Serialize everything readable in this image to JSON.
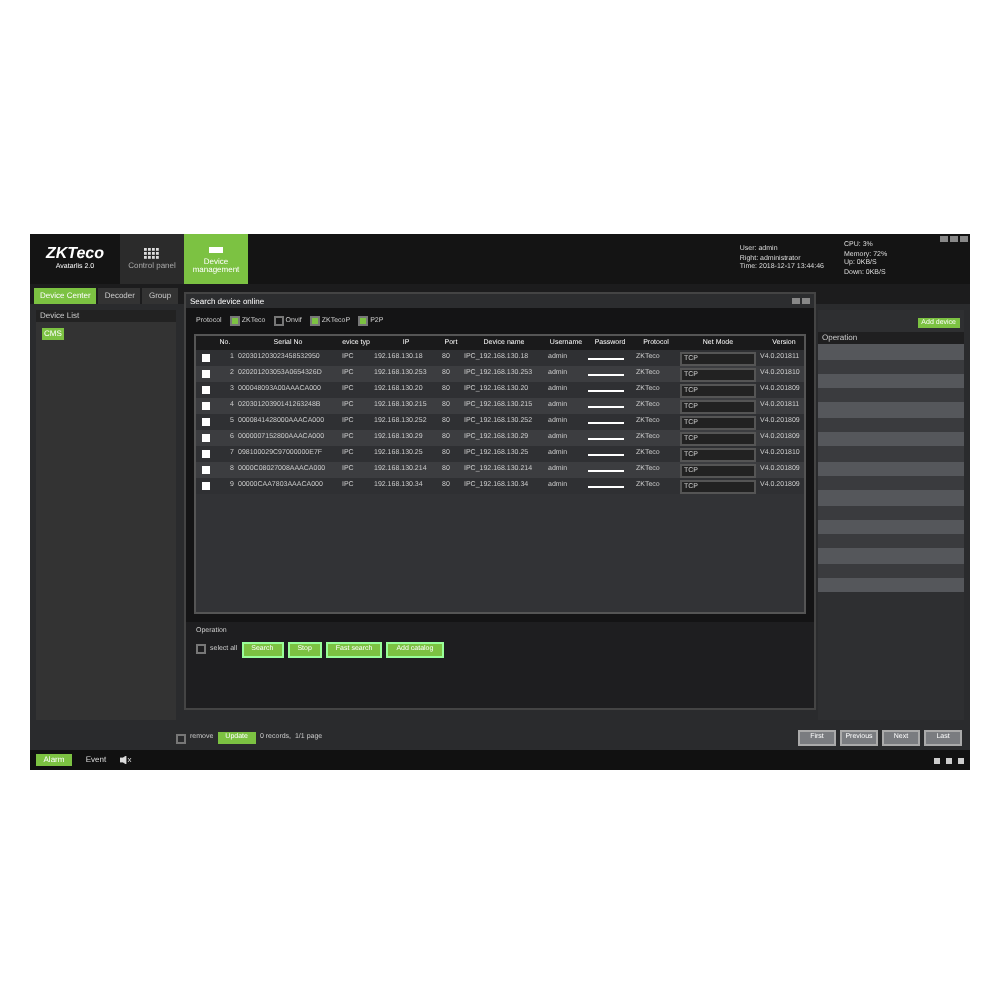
{
  "logo": {
    "brand": "ZKTeco",
    "product": "Avatarlis 2.0"
  },
  "main_tabs": [
    {
      "label": "Control panel",
      "selected": false
    },
    {
      "label": "Device management",
      "selected": true
    }
  ],
  "session": {
    "user": "User: admin",
    "right": "Right: administrator",
    "time": "Time: 2018-12-17 13:44:46"
  },
  "stats": [
    "CPU: 3%",
    "Memory: 72%",
    "Up: 0KB/S",
    "Down: 0KB/S"
  ],
  "sub_tabs": [
    {
      "label": "Device Center",
      "selected": true
    },
    {
      "label": "Decoder",
      "selected": false
    },
    {
      "label": "Group",
      "selected": false
    }
  ],
  "device_list": {
    "title": "Device List",
    "tree": [
      {
        "label": "CMS"
      }
    ]
  },
  "dialog": {
    "title": "Search device online",
    "protocol_label": "Protocol",
    "protocols": [
      {
        "label": "ZKTeco",
        "checked": true
      },
      {
        "label": "Onvif",
        "checked": false
      },
      {
        "label": "ZKTecoP",
        "checked": true
      },
      {
        "label": "P2P",
        "checked": true
      }
    ],
    "columns": [
      "No.",
      "Serial No",
      "evice typ",
      "IP",
      "Port",
      "Device name",
      "Username",
      "Password",
      "Protocol",
      "Net Mode",
      "Version"
    ],
    "rows": [
      {
        "checked": false,
        "no": "1",
        "serial": "020301203023458532950",
        "type": "IPC",
        "ip": "192.168.130.18",
        "port": "80",
        "name": "IPC_192.168.130.18",
        "username": "admin",
        "protocol": "ZKTeco",
        "net_mode": "TCP",
        "version": "V4.0.201811"
      },
      {
        "checked": false,
        "no": "2",
        "serial": "020201203053A0654326D",
        "type": "IPC",
        "ip": "192.168.130.253",
        "port": "80",
        "name": "IPC_192.168.130.253",
        "username": "admin",
        "protocol": "ZKTeco",
        "net_mode": "TCP",
        "version": "V4.0.201810"
      },
      {
        "checked": false,
        "no": "3",
        "serial": "000048093A00AAACA000",
        "type": "IPC",
        "ip": "192.168.130.20",
        "port": "80",
        "name": "IPC_192.168.130.20",
        "username": "admin",
        "protocol": "ZKTeco",
        "net_mode": "TCP",
        "version": "V4.0.201809"
      },
      {
        "checked": false,
        "no": "4",
        "serial": "02030120390141263248B",
        "type": "IPC",
        "ip": "192.168.130.215",
        "port": "80",
        "name": "IPC_192.168.130.215",
        "username": "admin",
        "protocol": "ZKTeco",
        "net_mode": "TCP",
        "version": "V4.0.201811"
      },
      {
        "checked": false,
        "no": "5",
        "serial": "0000841428000AAACA000",
        "type": "IPC",
        "ip": "192.168.130.252",
        "port": "80",
        "name": "IPC_192.168.130.252",
        "username": "admin",
        "protocol": "ZKTeco",
        "net_mode": "TCP",
        "version": "V4.0.201809"
      },
      {
        "checked": false,
        "no": "6",
        "serial": "0000007152800AAACA000",
        "type": "IPC",
        "ip": "192.168.130.29",
        "port": "80",
        "name": "IPC_192.168.130.29",
        "username": "admin",
        "protocol": "ZKTeco",
        "net_mode": "TCP",
        "version": "V4.0.201809"
      },
      {
        "checked": false,
        "no": "7",
        "serial": "098100029C97000000E7F",
        "type": "IPC",
        "ip": "192.168.130.25",
        "port": "80",
        "name": "IPC_192.168.130.25",
        "username": "admin",
        "protocol": "ZKTeco",
        "net_mode": "TCP",
        "version": "V4.0.201810"
      },
      {
        "checked": false,
        "no": "8",
        "serial": "0000C08027008AAACA000",
        "type": "IPC",
        "ip": "192.168.130.214",
        "port": "80",
        "name": "IPC_192.168.130.214",
        "username": "admin",
        "protocol": "ZKTeco",
        "net_mode": "TCP",
        "version": "V4.0.201809"
      },
      {
        "checked": false,
        "no": "9",
        "serial": "00000CAA7803AAACA000",
        "type": "IPC",
        "ip": "192.168.130.34",
        "port": "80",
        "name": "IPC_192.168.130.34",
        "username": "admin",
        "protocol": "ZKTeco",
        "net_mode": "TCP",
        "version": "V4.0.201809"
      }
    ],
    "operation_label": "Operation",
    "select_all": {
      "label": "select all",
      "checked": false
    },
    "buttons": [
      "Search",
      "Stop",
      "Fast search",
      "Add catalog"
    ]
  },
  "right_panel": {
    "add_button": "Add device",
    "header": "Operation"
  },
  "footer": {
    "remove": {
      "label": "remove",
      "checked": false
    },
    "update": "Update",
    "records": "0 records,  1/1 page",
    "pager": [
      "First",
      "Previous",
      "Next",
      "Last"
    ]
  },
  "status_bar": {
    "tabs": [
      {
        "label": "Alarm",
        "selected": true
      },
      {
        "label": "Event",
        "selected": false
      }
    ]
  }
}
